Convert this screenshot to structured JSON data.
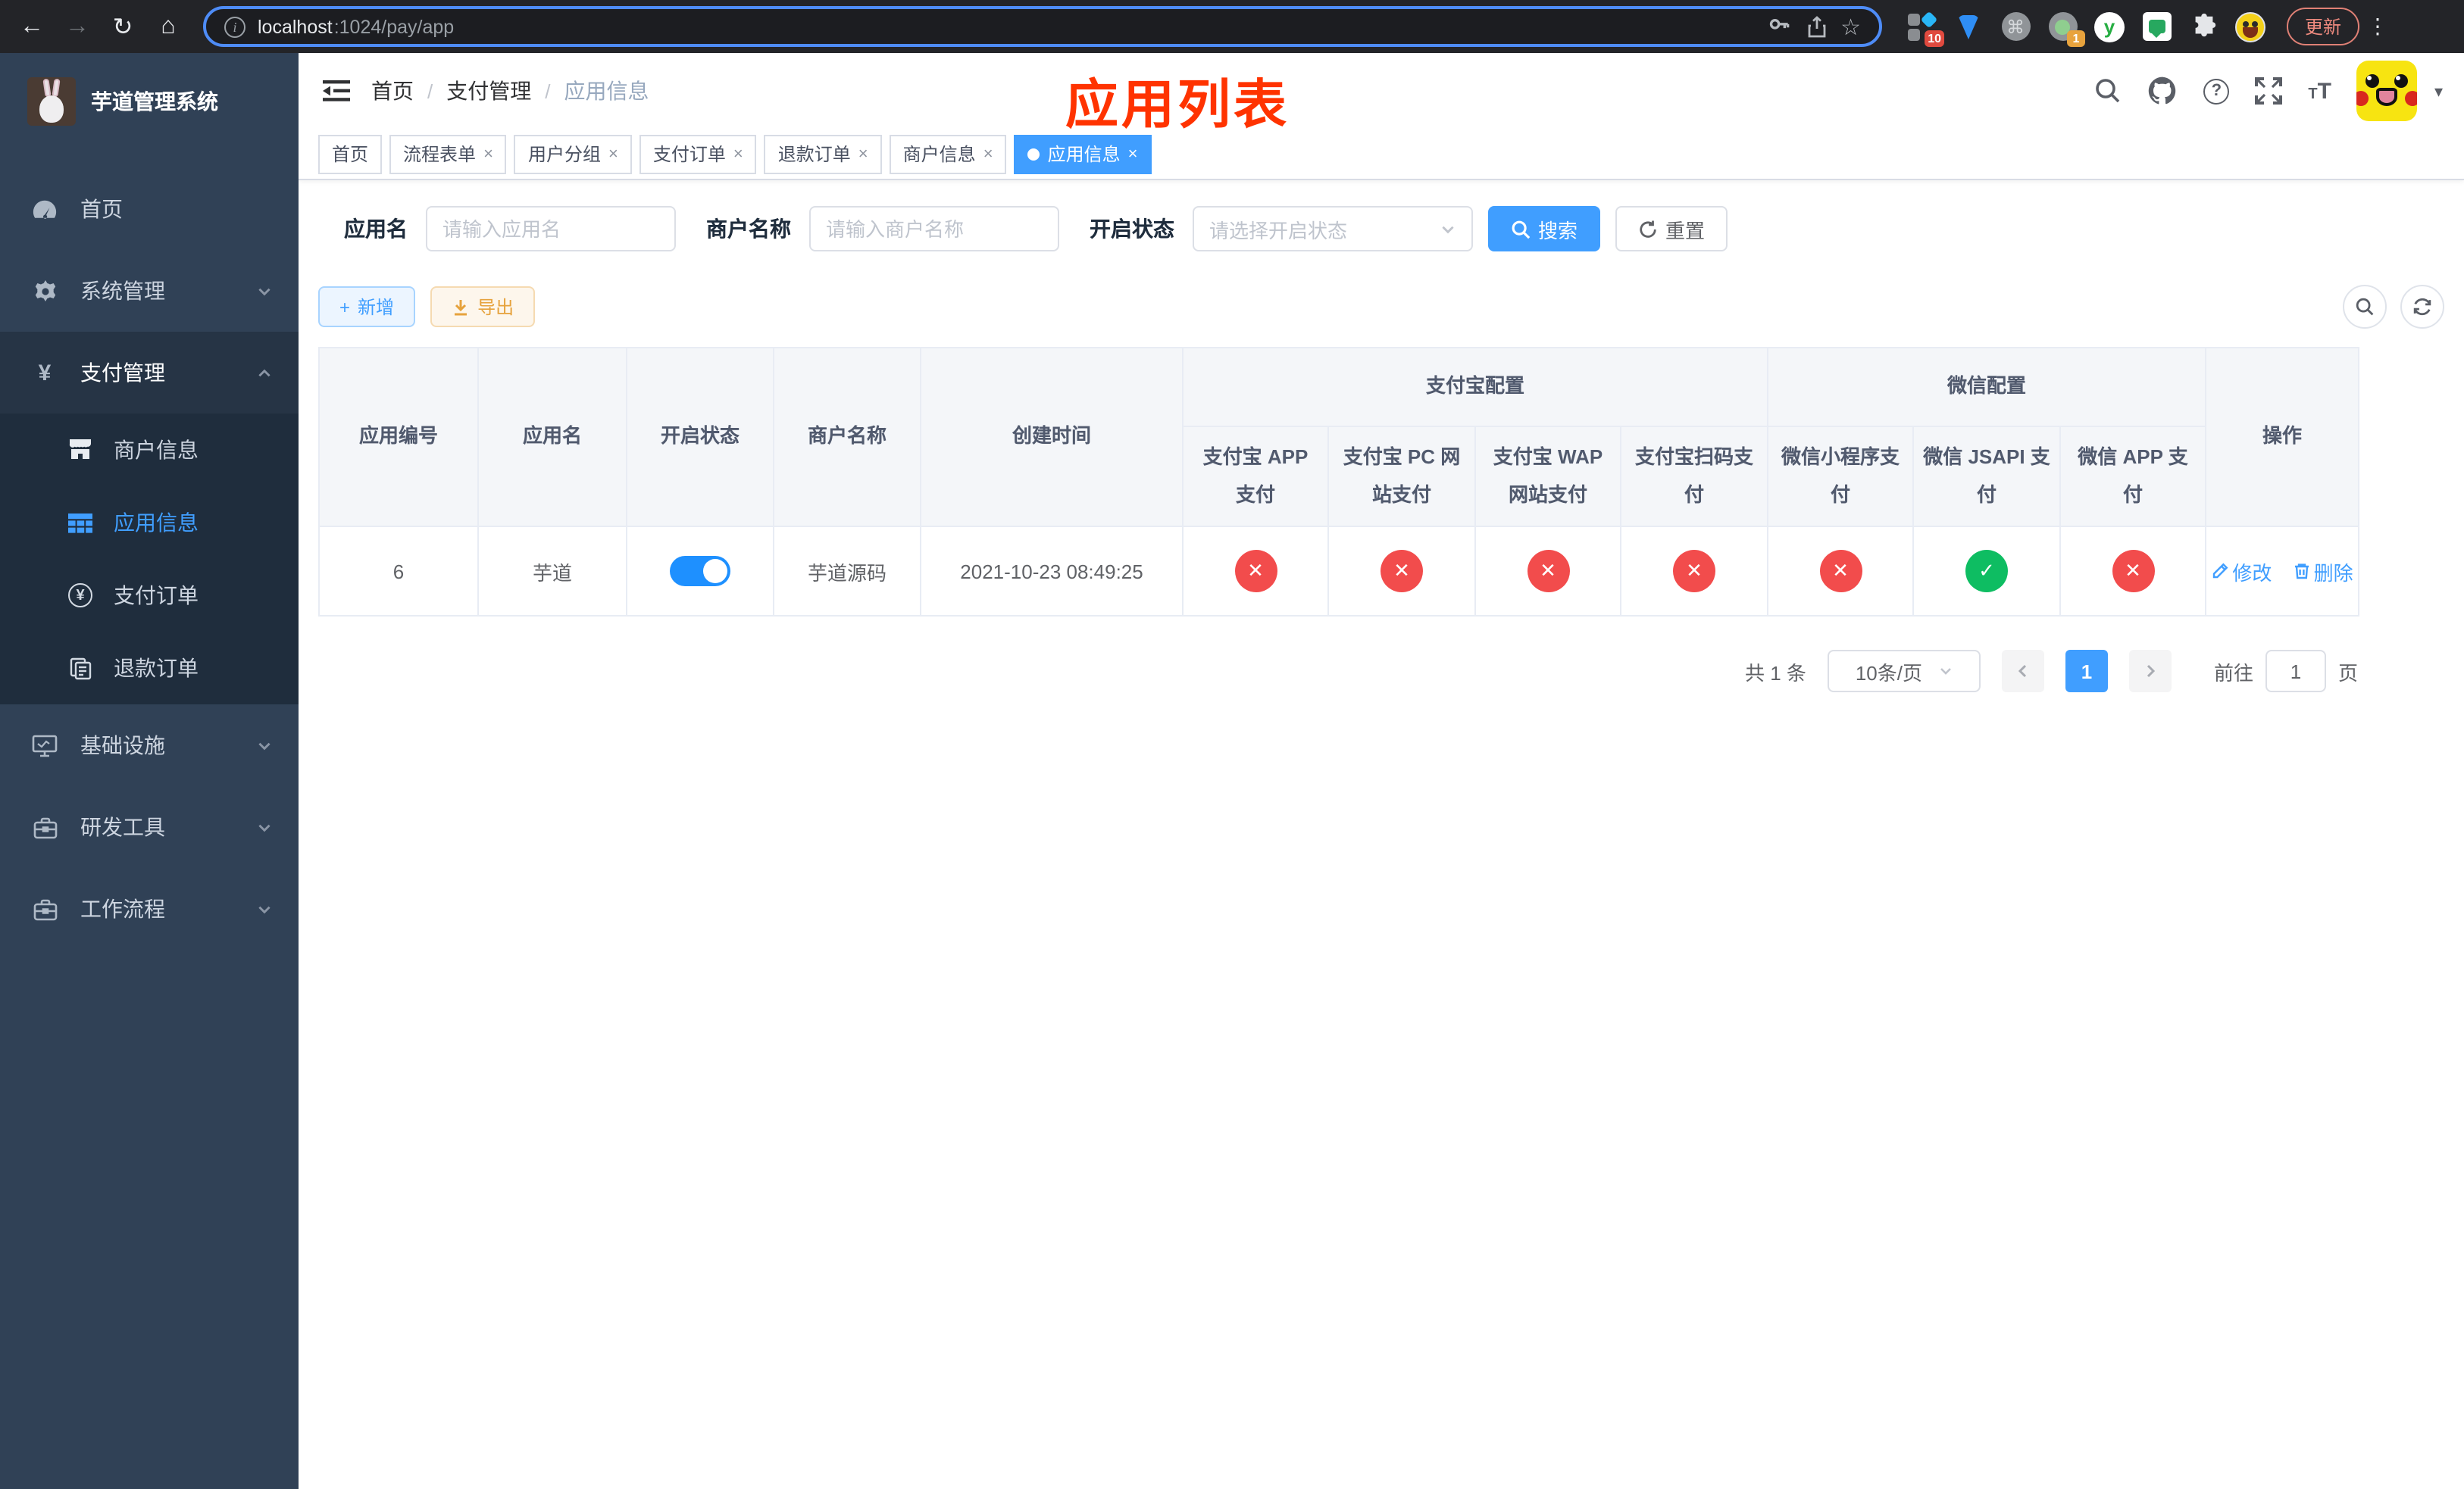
{
  "icons": {
    "back": "←",
    "forward": "→",
    "reload": "↻",
    "home": "⌂",
    "info": "i",
    "star": "☆",
    "command": "⌘",
    "y": "y",
    "kebab": "⋮",
    "question": "?",
    "caret": "▾",
    "slash": "/",
    "plus": "+",
    "yen": "¥",
    "font_big": "T",
    "font_small": "T"
  },
  "browser": {
    "url_host": "localhost",
    "url_path": ":1024/pay/app",
    "ext_badge_grid": "10",
    "ext_badge_status": "1",
    "update_label": "更新"
  },
  "sidebar": {
    "title": "芋道管理系统",
    "items": [
      {
        "label": "首页"
      },
      {
        "label": "系统管理"
      },
      {
        "label": "支付管理"
      },
      {
        "label": "商户信息"
      },
      {
        "label": "应用信息"
      },
      {
        "label": "支付订单"
      },
      {
        "label": "退款订单"
      },
      {
        "label": "基础设施"
      },
      {
        "label": "研发工具"
      },
      {
        "label": "工作流程"
      }
    ]
  },
  "header": {
    "breadcrumb": [
      "首页",
      "支付管理",
      "应用信息"
    ],
    "annotation": "应用列表"
  },
  "tabs": [
    {
      "label": "首页"
    },
    {
      "label": "流程表单"
    },
    {
      "label": "用户分组"
    },
    {
      "label": "支付订单"
    },
    {
      "label": "退款订单"
    },
    {
      "label": "商户信息"
    },
    {
      "label": "应用信息"
    }
  ],
  "filters": {
    "app_name_label": "应用名",
    "app_name_placeholder": "请输入应用名",
    "merchant_label": "商户名称",
    "merchant_placeholder": "请输入商户名称",
    "status_label": "开启状态",
    "status_placeholder": "请选择开启状态",
    "search_label": "搜索",
    "reset_label": "重置"
  },
  "toolbar": {
    "add_label": "新增",
    "export_label": "导出"
  },
  "table": {
    "headers": {
      "app_id": "应用编号",
      "app_name": "应用名",
      "status": "开启状态",
      "merchant": "商户名称",
      "created": "创建时间",
      "alipay_group": "支付宝配置",
      "wechat_group": "微信配置",
      "operation": "操作",
      "cols": [
        "支付宝 APP 支付",
        "支付宝 PC 网站支付",
        "支付宝 WAP 网站支付",
        "支付宝扫码支付",
        "微信小程序支付",
        "微信 JSAPI 支付",
        "微信 APP 支付"
      ]
    },
    "row": {
      "id": "6",
      "name": "芋道",
      "enabled": true,
      "merchant": "芋道源码",
      "created": "2021-10-23 08:49:25",
      "channels": [
        "no",
        "no",
        "no",
        "no",
        "no",
        "yes",
        "no"
      ],
      "edit_label": "修改",
      "delete_label": "删除"
    }
  },
  "pagination": {
    "total": "共 1 条",
    "page_size": "10条/页",
    "current_page": "1",
    "goto_label": "前往",
    "goto_value": "1",
    "page_unit": "页"
  },
  "colors": {
    "primary": "#409EFF",
    "danger": "#F24C4C",
    "success": "#0EBD62",
    "annotation": "#FF3300"
  }
}
